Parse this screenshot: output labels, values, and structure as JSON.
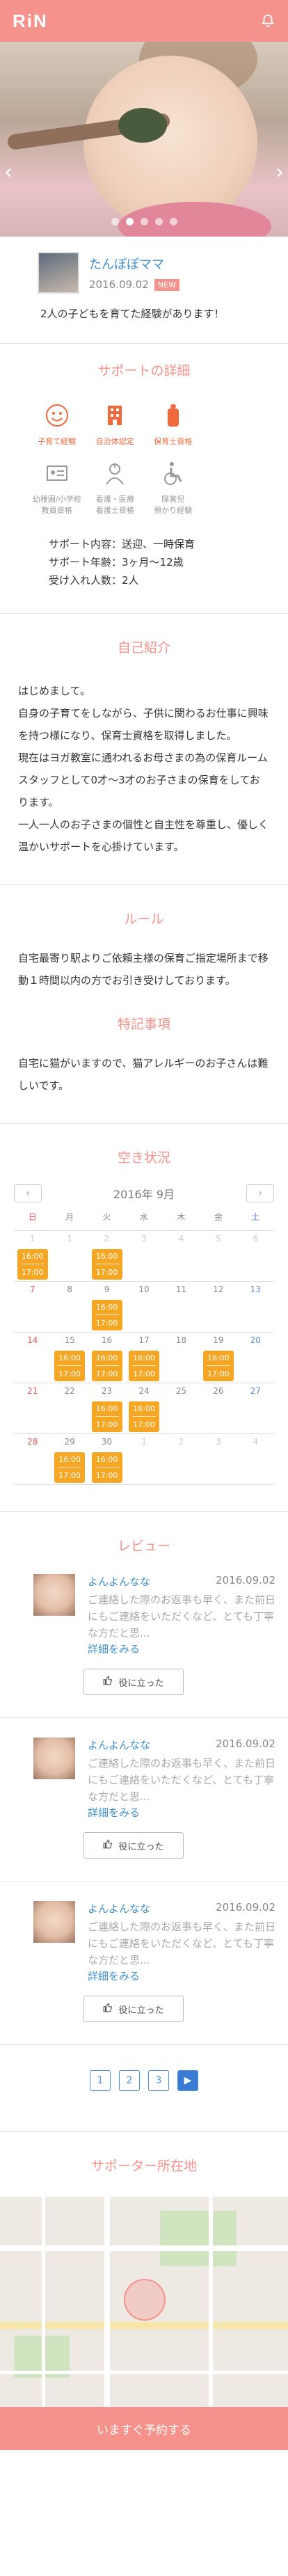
{
  "header": {
    "logo": "RiN"
  },
  "hero": {
    "slides": 5,
    "active": 1
  },
  "profile": {
    "name": "たんぽぽママ",
    "date": "2016.09.02",
    "badge": "NEW",
    "intro": "2人の子どもを育てた経験があります！"
  },
  "support": {
    "title": "サポートの詳細",
    "icons": [
      {
        "label": "子育て経験",
        "icon": "smiley-face-icon",
        "active": true
      },
      {
        "label": "自治体認定",
        "icon": "building-icon",
        "active": true
      },
      {
        "label": "保育士資格",
        "icon": "baby-bottle-icon",
        "active": true
      },
      {
        "label": "",
        "icon": "",
        "active": true
      },
      {
        "label": "幼稚園/小学校\n教員資格",
        "icon": "id-card-icon",
        "active": false
      },
      {
        "label": "看護・医療\n看護士資格",
        "icon": "nurse-icon",
        "active": false
      },
      {
        "label": "障害児\n預かり経験",
        "icon": "wheelchair-icon",
        "active": false
      },
      {
        "label": "",
        "icon": "",
        "active": false
      }
    ],
    "details": [
      "サポート内容：送迎、一時保育",
      "サポート年齢：3ヶ月〜12歳",
      "受け入れ人数：2人"
    ]
  },
  "self_intro": {
    "title": "自己紹介",
    "paragraphs": [
      "はじめまして。",
      "自身の子育てをしながら、子供に関わるお仕事に興味を持つ様になり、保育士資格を取得しました。",
      "現在はヨガ教室に通われるお母さまの為の保育ルームスタッフとして0才〜3才のお子さまの保育をしております。",
      "一人一人のお子さまの個性と自主性を尊重し、優しく温かいサポートを心掛けています。"
    ]
  },
  "rules": {
    "title": "ルール",
    "text": "自宅最寄り駅よりご依頼主様の保育ご指定場所まで移動１時間以内の方でお引き受けしております。",
    "notes_title": "特記事項",
    "notes_text": "自宅に猫がいますので、猫アレルギーのお子さんは難しいです。"
  },
  "calendar": {
    "title": "空き状況",
    "month": "2016年 9月",
    "prev": "‹",
    "next": "›",
    "weekdays": [
      "日",
      "月",
      "火",
      "水",
      "木",
      "金",
      "土"
    ],
    "slot_start": "16:00",
    "slot_end": "17:00",
    "weeks": [
      [
        {
          "d": "1",
          "dim": true,
          "slot": true
        },
        {
          "d": "1",
          "dim": true,
          "slot": false
        },
        {
          "d": "2",
          "dim": true,
          "slot": true
        },
        {
          "d": "3",
          "dim": true,
          "slot": false
        },
        {
          "d": "4",
          "dim": true,
          "slot": false
        },
        {
          "d": "5",
          "dim": true,
          "slot": false
        },
        {
          "d": "6",
          "dim": true,
          "slot": false
        }
      ],
      [
        {
          "d": "7",
          "dim": false,
          "slot": false
        },
        {
          "d": "8",
          "dim": false,
          "slot": false
        },
        {
          "d": "9",
          "dim": false,
          "slot": true
        },
        {
          "d": "10",
          "dim": false,
          "slot": false
        },
        {
          "d": "11",
          "dim": false,
          "slot": false
        },
        {
          "d": "12",
          "dim": false,
          "slot": false
        },
        {
          "d": "13",
          "dim": false,
          "slot": false
        }
      ],
      [
        {
          "d": "14",
          "dim": false,
          "slot": false
        },
        {
          "d": "15",
          "dim": false,
          "slot": true
        },
        {
          "d": "16",
          "dim": false,
          "slot": true
        },
        {
          "d": "17",
          "dim": false,
          "slot": true
        },
        {
          "d": "18",
          "dim": false,
          "slot": false
        },
        {
          "d": "19",
          "dim": false,
          "slot": true
        },
        {
          "d": "20",
          "dim": false,
          "slot": false
        }
      ],
      [
        {
          "d": "21",
          "dim": false,
          "slot": false
        },
        {
          "d": "22",
          "dim": false,
          "slot": false
        },
        {
          "d": "23",
          "dim": false,
          "slot": true
        },
        {
          "d": "24",
          "dim": false,
          "slot": true
        },
        {
          "d": "25",
          "dim": false,
          "slot": false
        },
        {
          "d": "26",
          "dim": false,
          "slot": false
        },
        {
          "d": "27",
          "dim": false,
          "slot": false
        }
      ],
      [
        {
          "d": "28",
          "dim": false,
          "slot": false
        },
        {
          "d": "29",
          "dim": false,
          "slot": true
        },
        {
          "d": "30",
          "dim": false,
          "slot": true
        },
        {
          "d": "1",
          "dim": true,
          "slot": false
        },
        {
          "d": "2",
          "dim": true,
          "slot": false
        },
        {
          "d": "3",
          "dim": true,
          "slot": false
        },
        {
          "d": "4",
          "dim": true,
          "slot": false
        }
      ]
    ]
  },
  "reviews": {
    "title": "レビュー",
    "more_label": "詳細をみる",
    "helpful_label": "役に立った",
    "items": [
      {
        "name": "よんよんなな",
        "date": "2016.09.02",
        "text": "ご連絡した際のお返事も早く、また前日にもご連絡をいただくなど、とても丁寧な方だと思..."
      },
      {
        "name": "よんよんなな",
        "date": "2016.09.02",
        "text": "ご連絡した際のお返事も早く、また前日にもご連絡をいただくなど、とても丁寧な方だと思..."
      },
      {
        "name": "よんよんなな",
        "date": "2016.09.02",
        "text": "ご連絡した際のお返事も早く、また前日にもご連絡をいただくなど、とても丁寧な方だと思..."
      }
    ],
    "pages": [
      "1",
      "2",
      "3"
    ],
    "next_page": "▶"
  },
  "location": {
    "title": "サポーター所在地"
  },
  "footer": {
    "reserve_label": "いますぐ予約する"
  },
  "colors": {
    "brand": "#f6928c",
    "link": "#3f8fd2",
    "slot": "#f5a623"
  }
}
